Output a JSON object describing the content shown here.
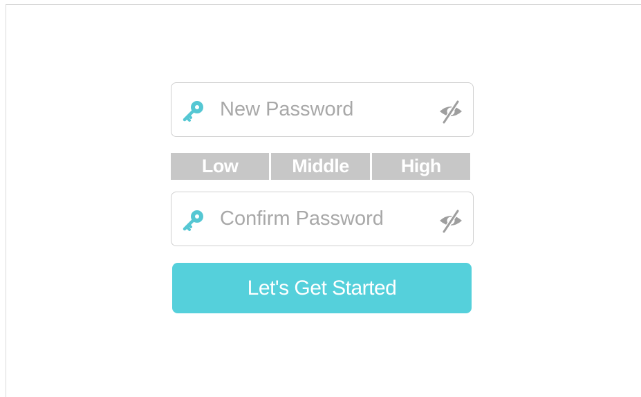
{
  "colors": {
    "accent": "#55d0db",
    "key_icon": "#55c7d3",
    "strength_bar": "#c7c7c7",
    "border": "#cfcfcf",
    "placeholder": "#a8a8a8",
    "eye_icon": "#9e9e9e"
  },
  "form": {
    "new_password": {
      "icon": "key-icon",
      "placeholder": "New Password",
      "value": "",
      "toggle_icon": "eye-slash-icon"
    },
    "strength": {
      "levels": [
        "Low",
        "Middle",
        "High"
      ]
    },
    "confirm_password": {
      "icon": "key-icon",
      "placeholder": "Confirm Password",
      "value": "",
      "toggle_icon": "eye-slash-icon"
    },
    "submit_label": "Let's Get Started"
  }
}
